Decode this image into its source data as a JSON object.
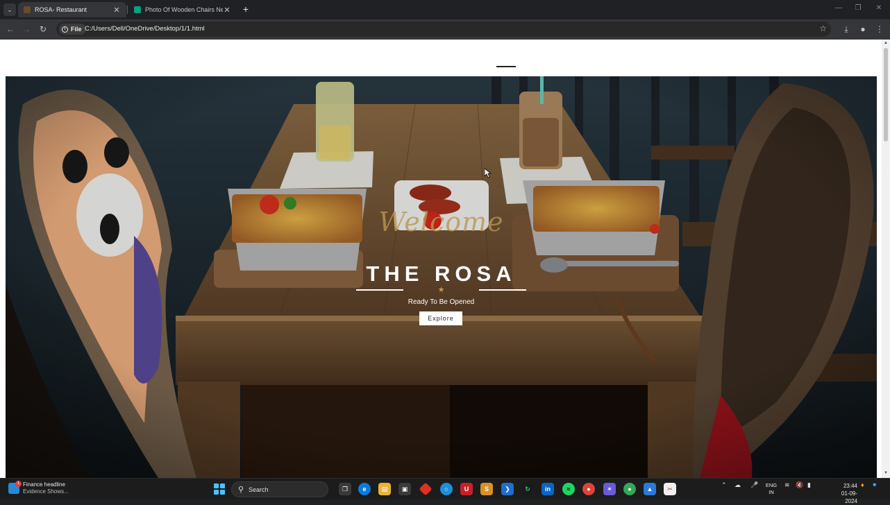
{
  "browser": {
    "tabs": [
      {
        "title": "ROSA- Restaurant",
        "active": true
      },
      {
        "title": "Photo Of Wooden Chairs Near",
        "active": false
      }
    ],
    "new_tab_label": "+",
    "site_info_label": "File",
    "url": "C:/Users/Dell/OneDrive/Desktop/1/1.html"
  },
  "hero": {
    "script_heading": "Welcome",
    "brand": "THE ROSA",
    "tagline": "Ready To Be Opened",
    "button_label": "Explore",
    "accent_color": "#c79a4a"
  },
  "taskbar": {
    "widget_title": "Finance headline",
    "widget_subtitle": "Evidence Shows...",
    "widget_badge": "1",
    "search_label": "Search",
    "language_line1": "ENG",
    "language_line2": "IN",
    "time": "23:44",
    "date": "01-09-2024",
    "notification_badge": "1"
  }
}
